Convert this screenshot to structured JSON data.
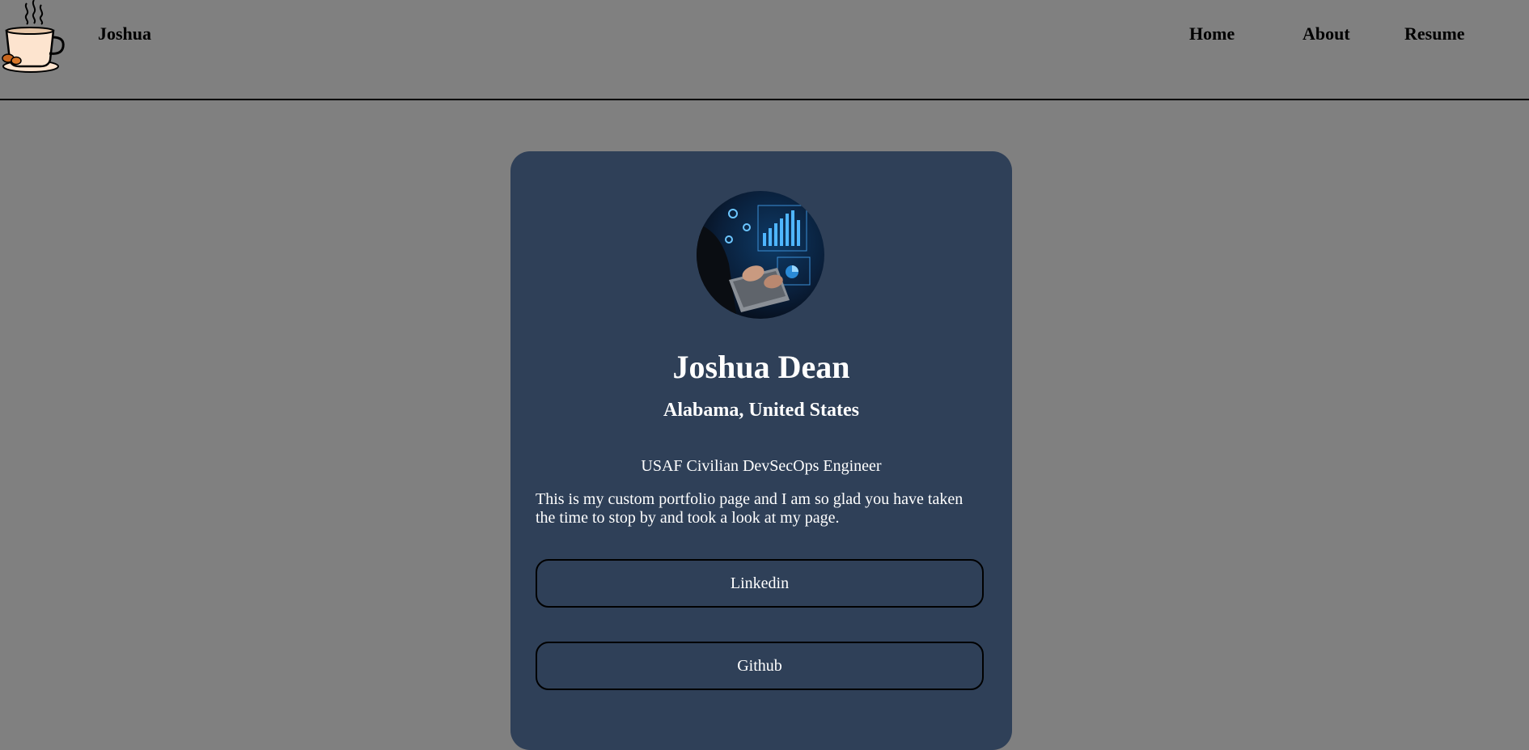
{
  "header": {
    "brand": "Joshua",
    "logo_icon": "coffee-cup-icon",
    "nav": [
      {
        "label": "Home"
      },
      {
        "label": "About"
      },
      {
        "label": "Resume"
      }
    ]
  },
  "profile": {
    "avatar_icon": "laptop-analytics-photo",
    "name": "Joshua Dean",
    "location": "Alabama, United States",
    "role": "USAF Civilian DevSecOps Engineer",
    "bio": "This is my custom portfolio page and I am so glad you have taken the time to stop by and took a look at my page.",
    "links": [
      {
        "label": "Linkedin"
      },
      {
        "label": "Github"
      }
    ]
  },
  "colors": {
    "page_background": "#808080",
    "card_background": "#2f4058",
    "text_light": "#ffffff",
    "text_dark": "#000000"
  }
}
